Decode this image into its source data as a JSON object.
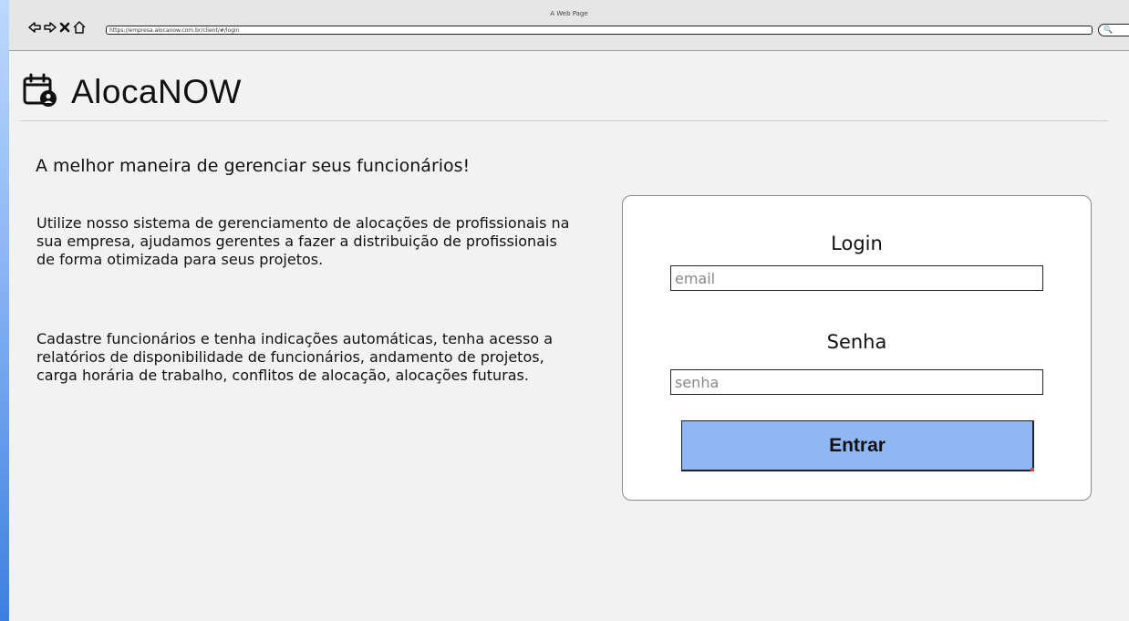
{
  "browser": {
    "title": "A Web Page",
    "url": "https://empresa.alocanow.com.br/client/#/login"
  },
  "header": {
    "brand_icon": "calendar-user-icon",
    "brand_name": "AlocaNOW"
  },
  "main": {
    "tagline": "A melhor maneira de gerenciar seus funcionários!",
    "paragraph_1": "Utilize nosso sistema de gerenciamento de alocações de profissionais na sua empresa, ajudamos gerentes a fazer a distribuição de profissionais de forma otimizada para seus projetos.",
    "paragraph_2": "Cadastre funcionários e tenha indicações automáticas, tenha acesso a relatórios de disponibilidade de funcionários, andamento de projetos, carga horária de trabalho, conflitos de alocação, alocações futuras."
  },
  "login_form": {
    "login_label": "Login",
    "email_placeholder": "email",
    "password_label": "Senha",
    "password_placeholder": "senha",
    "submit_label": "Entrar",
    "submit_color": "#8fb7f3"
  }
}
